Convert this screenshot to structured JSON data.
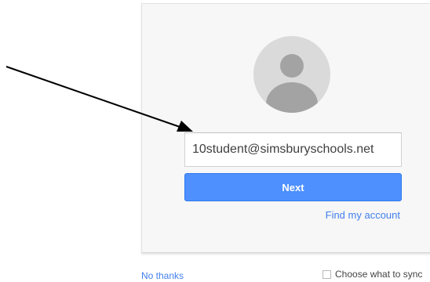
{
  "signin": {
    "avatar_icon": "default-avatar-icon",
    "email_value": "10student@simsburyschools.net",
    "next_label": "Next",
    "find_account_label": "Find my account"
  },
  "footer": {
    "no_thanks_label": "No thanks",
    "sync_label": "Choose what to sync",
    "sync_checked": false
  },
  "colors": {
    "accent": "#4d90fe",
    "link": "#427fed",
    "card_bg": "#f7f7f7"
  }
}
